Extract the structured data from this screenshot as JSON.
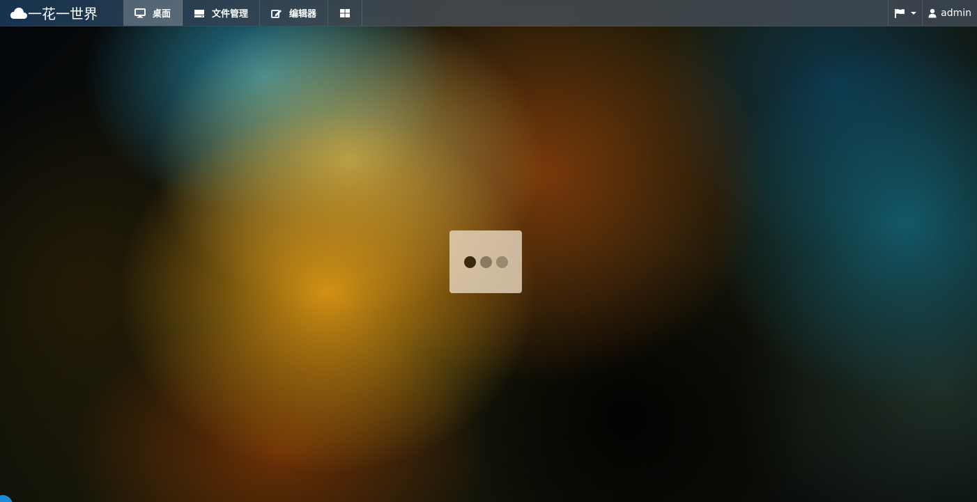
{
  "brand": {
    "logo_icon": "cloud-icon",
    "title": "一花一世界"
  },
  "nav": {
    "items": [
      {
        "label": "桌面",
        "icon": "monitor-icon",
        "active": true
      },
      {
        "label": "文件管理",
        "icon": "hdd-icon",
        "active": false
      },
      {
        "label": "编辑器",
        "icon": "edit-icon",
        "active": false
      },
      {
        "label": "",
        "icon": "grid-icon",
        "active": false
      }
    ]
  },
  "nav_right": {
    "flag_icon": "flag-icon",
    "user_icon": "user-icon",
    "username": "admin"
  },
  "loading": {
    "dots": 3,
    "active_dot": 1
  },
  "colors": {
    "accent": "#1a8ad6",
    "loading_box": "#e6d7be"
  }
}
